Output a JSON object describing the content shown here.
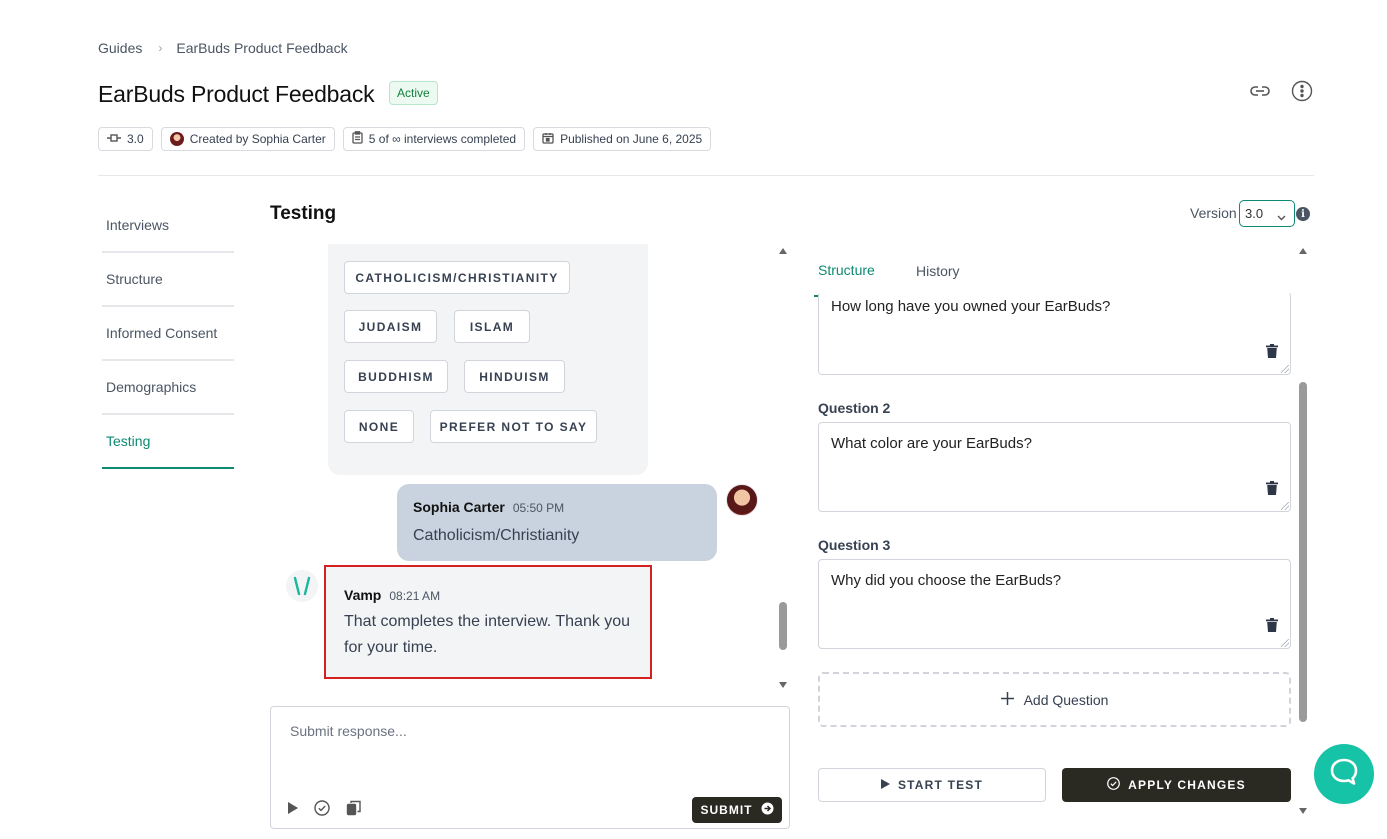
{
  "breadcrumb": {
    "root": "Guides",
    "current": "EarBuds Product Feedback"
  },
  "header": {
    "title": "EarBuds Product Feedback",
    "status": "Active",
    "icons": [
      "link-icon",
      "more-vertical-icon"
    ]
  },
  "meta": {
    "version": "3.0",
    "created_by": "Created by Sophia Carter",
    "interviews": "5 of ∞ interviews completed",
    "published": "Published on June 6, 2025"
  },
  "sidebar": {
    "items": [
      {
        "label": "Interviews",
        "active": false
      },
      {
        "label": "Structure",
        "active": false
      },
      {
        "label": "Informed Consent",
        "active": false
      },
      {
        "label": "Demographics",
        "active": false
      },
      {
        "label": "Testing",
        "active": true
      }
    ]
  },
  "section": {
    "title": "Testing",
    "version_label": "Version",
    "version_value": "3.0"
  },
  "chat": {
    "options": [
      "CATHOLICISM/CHRISTIANITY",
      "JUDAISM",
      "ISLAM",
      "BUDDHISM",
      "HINDUISM",
      "NONE",
      "PREFER NOT TO SAY"
    ],
    "messages": [
      {
        "sender": "Sophia Carter",
        "time": "05:50 PM",
        "text": "Catholicism/Christianity"
      },
      {
        "sender": "Vamp",
        "time": "08:21 AM",
        "text": "That completes the interview. Thank you for your time."
      }
    ],
    "chat_scroll_position": 0.92
  },
  "response": {
    "placeholder": "Submit response...",
    "submit_label": "SUBMIT"
  },
  "structure": {
    "tabs": [
      {
        "label": "Structure",
        "active": true
      },
      {
        "label": "History",
        "active": false
      }
    ],
    "questions": [
      {
        "label": "",
        "text": "How long have you owned your EarBuds?"
      },
      {
        "label": "Question 2",
        "text": "What color are your EarBuds?"
      },
      {
        "label": "Question 3",
        "text": "Why did you choose the EarBuds?"
      }
    ],
    "add_question_label": "Add Question",
    "start_test_label": "START TEST",
    "apply_changes_label": "APPLY CHANGES",
    "structure_scroll_position": 0.6
  },
  "colors": {
    "accent": "#0f8a72",
    "dark_button": "#2b2a22",
    "fab": "#17c3a6",
    "highlight_border": "#d42020"
  }
}
